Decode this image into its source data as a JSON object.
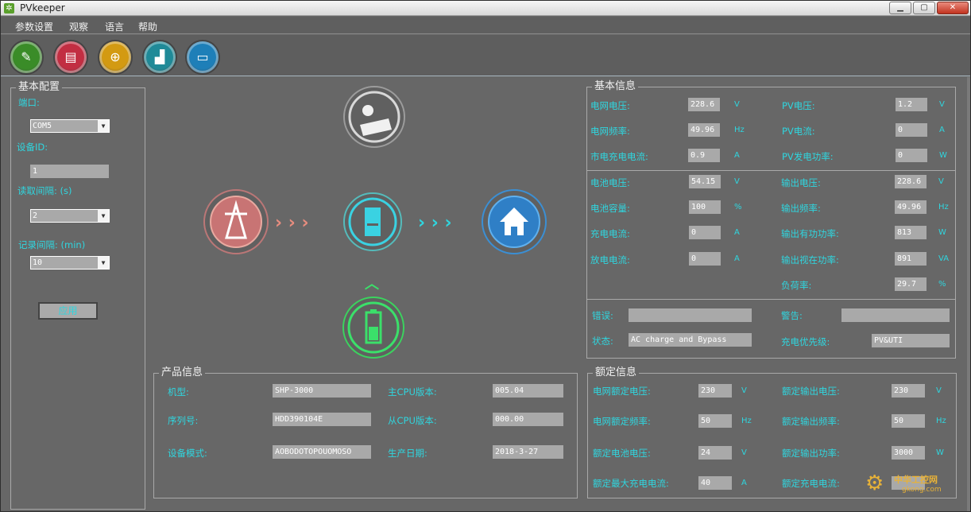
{
  "window": {
    "title": "PVkeeper",
    "min": "▁",
    "max": "▢",
    "close": "✕",
    "icon": "✲"
  },
  "menu": [
    "参数设置",
    "观察",
    "语言",
    "帮助"
  ],
  "toolbar": [
    {
      "icon": "pencil-icon",
      "glyph": "✎",
      "color": "#3a8c28"
    },
    {
      "icon": "book-icon",
      "glyph": "▤",
      "color": "#c22e42"
    },
    {
      "icon": "globe-icon",
      "glyph": "⊕",
      "color": "#d39a12"
    },
    {
      "icon": "chart-icon",
      "glyph": "▟",
      "color": "#1f8a98"
    },
    {
      "icon": "monitor-icon",
      "glyph": "▭",
      "color": "#1e7fb8"
    }
  ],
  "config": {
    "title": "基本配置",
    "port_label": "端口:",
    "port_value": "COM5",
    "device_id_label": "设备ID:",
    "device_id_value": "1",
    "read_interval_label": "读取间隔: (s)",
    "read_interval_value": "2",
    "record_interval_label": "记录间隔: (min)",
    "record_interval_value": "10",
    "apply": "应用"
  },
  "flow": {
    "solar_icon": "solar-panel-icon",
    "grid_icon": "power-tower-icon",
    "inverter_icon": "inverter-icon",
    "home_icon": "home-icon",
    "battery_icon": "battery-icon",
    "arrow_left": "› › ›",
    "arrow_right": "› › ›",
    "arrow_up": "︿"
  },
  "basic": {
    "title": "基本信息",
    "left": [
      {
        "label": "电网电压:",
        "value": "228.6",
        "unit": "V"
      },
      {
        "label": "电网频率:",
        "value": "49.96",
        "unit": "Hz"
      },
      {
        "label": "市电充电电流:",
        "value": "0.9",
        "unit": "A"
      }
    ],
    "right": [
      {
        "label": "PV电压:",
        "value": "1.2",
        "unit": "V"
      },
      {
        "label": "PV电流:",
        "value": "0",
        "unit": "A"
      },
      {
        "label": "PV发电功率:",
        "value": "0",
        "unit": "W"
      }
    ],
    "left2": [
      {
        "label": "电池电压:",
        "value": "54.15",
        "unit": "V"
      },
      {
        "label": "电池容量:",
        "value": "100",
        "unit": "%"
      },
      {
        "label": "充电电流:",
        "value": "0",
        "unit": "A"
      },
      {
        "label": "放电电流:",
        "value": "0",
        "unit": "A"
      }
    ],
    "right2": [
      {
        "label": "输出电压:",
        "value": "228.6",
        "unit": "V"
      },
      {
        "label": "输出频率:",
        "value": "49.96",
        "unit": "Hz"
      },
      {
        "label": "输出有功功率:",
        "value": "813",
        "unit": "W"
      },
      {
        "label": "输出视在功率:",
        "value": "891",
        "unit": "VA"
      },
      {
        "label": "负荷率:",
        "value": "29.7",
        "unit": "%"
      }
    ],
    "error_label": "错误:",
    "error_value": "",
    "warning_label": "警告:",
    "warning_value": "",
    "status_label": "状态:",
    "status_value": "AC charge and Bypass",
    "priority_label": "充电优先级:",
    "priority_value": "PV&UTI"
  },
  "product": {
    "title": "产品信息",
    "left": [
      {
        "label": "机型:",
        "value": "SHP-3000"
      },
      {
        "label": "序列号:",
        "value": "HDD390104E"
      },
      {
        "label": "设备模式:",
        "value": "AOBODOTOPOUOMOSO"
      }
    ],
    "right": [
      {
        "label": "主CPU版本:",
        "value": "005.04"
      },
      {
        "label": "从CPU版本:",
        "value": "000.00"
      },
      {
        "label": "生产日期:",
        "value": "2018-3-27"
      }
    ]
  },
  "rated": {
    "title": "额定信息",
    "left": [
      {
        "label": "电网额定电压:",
        "value": "230",
        "unit": "V"
      },
      {
        "label": "电网额定频率:",
        "value": "50",
        "unit": "Hz"
      },
      {
        "label": "额定电池电压:",
        "value": "24",
        "unit": "V"
      },
      {
        "label": "额定最大充电电流:",
        "value": "40",
        "unit": "A"
      }
    ],
    "right": [
      {
        "label": "额定输出电压:",
        "value": "230",
        "unit": "V"
      },
      {
        "label": "额定输出频率:",
        "value": "50",
        "unit": "Hz"
      },
      {
        "label": "额定输出功率:",
        "value": "3000",
        "unit": "W"
      },
      {
        "label": "额定充电电流:",
        "value": "",
        "unit": ""
      }
    ]
  },
  "watermark": {
    "line1": "中华工控网",
    "line2": "gkong.com"
  }
}
